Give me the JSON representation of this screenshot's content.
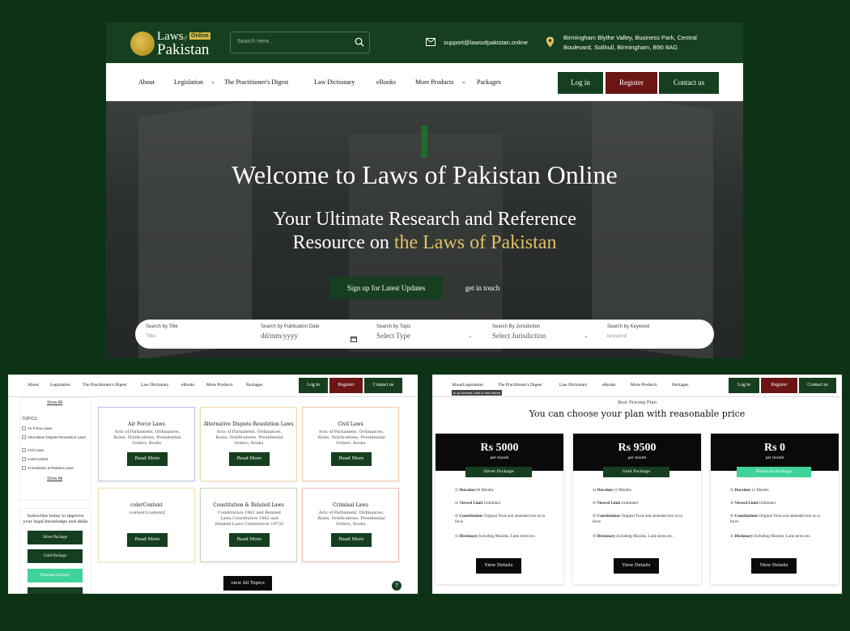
{
  "header": {
    "logo": {
      "line1": "Laws",
      "line1_small": "of",
      "line2": "Pakistan",
      "badge": "Online"
    },
    "search_placeholder": "Search Here...",
    "email": "support@lawsofpakistan.online",
    "address_line1": "Birmingham Blythe Valley, Business Park, Central",
    "address_line2": "Boulevard, Solihull, Birmingham, B90 8AG"
  },
  "nav": {
    "items": [
      "About",
      "Legislation",
      "The Practitioner's Digest",
      "Law Dictionary",
      "eBooks",
      "More Products",
      "Packages"
    ],
    "login": "Log in",
    "register": "Register",
    "contact": "Contact us"
  },
  "hero": {
    "title": "Welcome to Laws of Pakistan Online",
    "subtitle_line1": "Your Ultimate Research and Reference",
    "subtitle_line2_plain": "Resource on ",
    "subtitle_line2_gold": "the Laws of Pakistan",
    "signup": "Sign up for Latest Updates",
    "get_in_touch": "get in touch"
  },
  "searchbar": {
    "fields": [
      {
        "label": "Search by Title",
        "placeholder": "Title"
      },
      {
        "label": "Search by Publication Date",
        "value": "dd/mm/yyyy"
      },
      {
        "label": "Search by Topic",
        "value": "Select Type"
      },
      {
        "label": "Search By Jurisdiction",
        "value": "Select Jurisdiction"
      },
      {
        "label": "Search by Keyword",
        "placeholder": "keyword"
      }
    ]
  },
  "topics_page": {
    "show_all_top": "Show All",
    "topics_heading": "TOPICS",
    "topics": [
      "Air Force Laws",
      "Alternative Dispute Resolution Laws",
      "Civil Laws",
      "colerContent",
      "Constitution & Related Laws"
    ],
    "show_all_bottom": "Show All",
    "subscribe_line1": "Subscribe today to improve",
    "subscribe_line2": "your legal knowledge and skills",
    "packages": [
      "Silver Package",
      "Gold Package",
      "Platinum Package"
    ],
    "cards": [
      {
        "title": "Air Force Laws",
        "desc": "Acts of Parliament, Ordinances, Rules, Notifications, Presidential Orders, Books.",
        "button": "Read More"
      },
      {
        "title": "Alternative Dispute Resolution Laws",
        "desc": "Acts of Parliament, Ordinances, Rules, Notifications, Presidential Orders, Books.",
        "button": "Read More"
      },
      {
        "title": "Civil Laws",
        "desc": "Acts of Parliament, Ordinances, Rules, Notifications, Presidential Orders, Books.",
        "button": "Read More"
      },
      {
        "title": "colerContent",
        "desc": "content1content2",
        "button": "Read More"
      },
      {
        "title": "Constitution & Related Laws",
        "desc": "Constitution 1962 and Related Laws,Constitution 1962 and Related Laws,Constitution 19732",
        "button": "Read More"
      },
      {
        "title": "Criminal Laws",
        "desc": "Acts of Parliament, Ordinances, Rules, Notifications, Presidential Orders, Books.",
        "button": "Read More"
      }
    ],
    "view_all": "view All Topics",
    "help": "?"
  },
  "pricing_page": {
    "tooltip": "to go forward, hold to see history",
    "eyebrow": "Best Pricing Plan",
    "heading": "You can choose your plan with reasonable price",
    "plans": [
      {
        "price": "Rs 5000",
        "per": "per month",
        "name": "Silver Package",
        "duration": "06 Months",
        "limit": "Unlimited",
        "const_b": "Constitutions",
        "const": " Original Texts and amended text as in force",
        "dict_b": "Dictionary",
        "dict": " Including Maxims, Latin terms etc.",
        "button": "View Details"
      },
      {
        "price": "Rs 9500",
        "per": "per month",
        "name": "Gold Package",
        "duration": "12 Months",
        "limit": "Unlimited",
        "const_b": "Constitutions",
        "const": " Original Texts and amended text as in force",
        "dict_b": "Dictionary",
        "dict": " Including Maxims, Latin terms etc.",
        "button": "View Details"
      },
      {
        "price": "Rs 0",
        "per": "per month",
        "name": "Platinum Package",
        "duration": "12 Months",
        "limit": "Unlimited",
        "const_b": "Constitutions",
        "const": " Original Texts and amended text as in force",
        "dict_b": "Dictionary",
        "dict": " Including Maxims, Latin terms etc.",
        "button": "View Details"
      }
    ],
    "labels": {
      "duration": "Duration",
      "limit": "Viewed Limit"
    }
  },
  "colors": {
    "brand_green": "#163f1f",
    "maroon": "#6b1515",
    "gold": "#e2c064",
    "platinum": "#3fd39a",
    "bg": "#0d3317"
  }
}
